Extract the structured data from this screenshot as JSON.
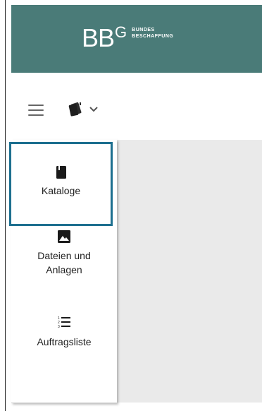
{
  "header": {
    "logo_mark": "BB",
    "logo_g": "G",
    "logo_line1": "BUNDES",
    "logo_line2": "BESCHAFFUNG",
    "background": "#4a7b78"
  },
  "toolbar": {
    "menu_icon": "hamburger-icon",
    "switcher_icon": "catalog-cards-icon",
    "switcher_caret": "chevron-down-icon"
  },
  "sidebar": {
    "items": [
      {
        "label": "Kataloge",
        "icon": "book-icon",
        "active": true
      },
      {
        "label": "Dateien und Anlagen",
        "icon": "image-icon",
        "active": false
      },
      {
        "label": "Auftragsliste",
        "icon": "numbered-list-icon",
        "active": false
      }
    ]
  },
  "colors": {
    "accent_border": "#1d6f8f",
    "content_background": "#eaeaea"
  }
}
